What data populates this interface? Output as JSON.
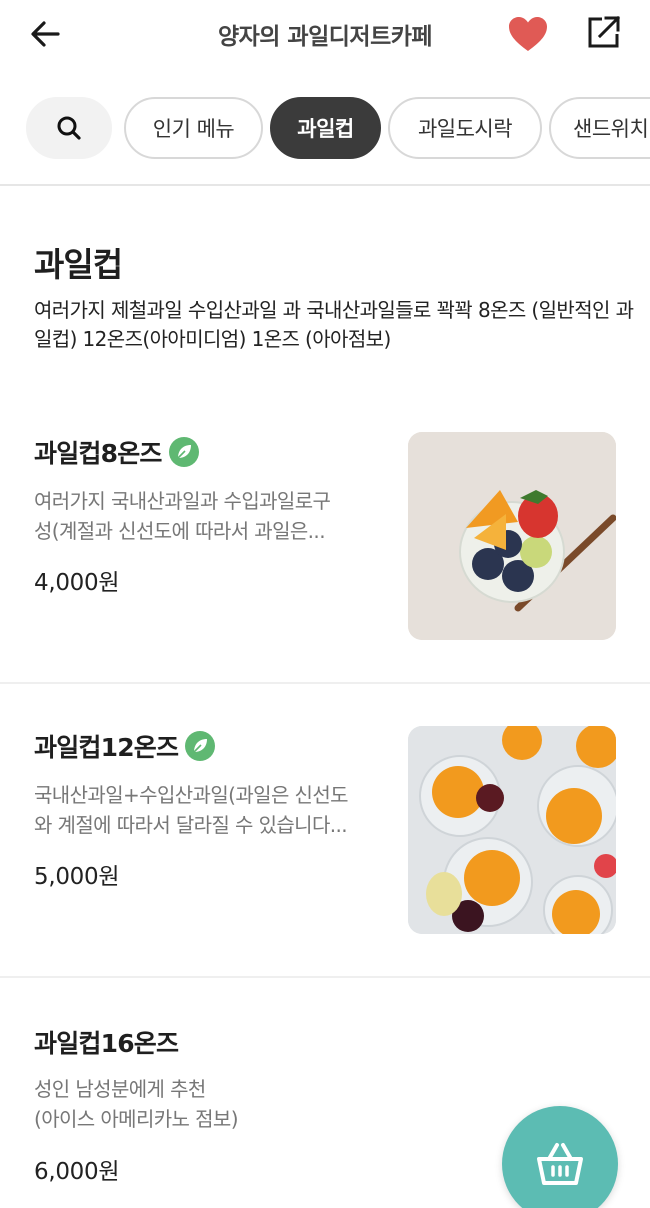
{
  "header": {
    "title": "양자의 과일디저트카페",
    "back_icon": "arrow-left-icon",
    "heart_icon": "heart-icon",
    "share_icon": "share-icon",
    "heart_color": "#e05a55"
  },
  "chips": {
    "search_icon": "search-icon",
    "items": [
      {
        "label": "인기 메뉴"
      },
      {
        "label": "과일컵"
      },
      {
        "label": "과일도시락"
      },
      {
        "label": "샌드위치"
      }
    ],
    "active_label": "과일컵"
  },
  "section": {
    "title": "과일컵",
    "description": "여러가지 제철과일 수입산과일 과 국내산과일들로 꽉꽉 8온즈 (일반적인 과일컵) 12온즈(아아미디엄) 1온즈 (아아점보)"
  },
  "menu": [
    {
      "name": "과일컵8온즈",
      "desc_line1": "여러가지 국내산과일과 수입과일로구",
      "desc_line2": "성(계절과 신선도에 따라서 과일은...",
      "price": "4,000원",
      "badge_icon": "leaf-icon"
    },
    {
      "name": "과일컵12온즈",
      "desc_line1": "국내산과일+수입산과일(과일은 신선도",
      "desc_line2": "와 계절에 따라서 달라질 수 있습니다...",
      "price": "5,000원",
      "badge_icon": "leaf-icon"
    },
    {
      "name": "과일컵16온즈",
      "desc_line1": "성인 남성분에게 추천",
      "desc_line2": "(아이스 아메리카노 점보)",
      "price": "6,000원"
    }
  ],
  "cart": {
    "icon": "basket-icon",
    "color": "#5cbcb3"
  },
  "colors": {
    "active_chip": "#3b3b3b",
    "badge_green": "#5fb872"
  }
}
